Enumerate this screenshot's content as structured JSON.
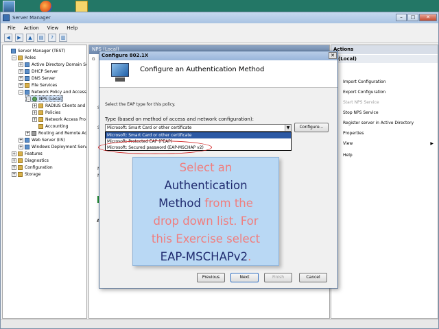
{
  "window": {
    "title": "Server Manager",
    "controls": {
      "minimize": "–",
      "maximize": "□",
      "close": "✕"
    }
  },
  "menu": [
    "File",
    "Action",
    "View",
    "Help"
  ],
  "toolbar_icons": [
    "back-arrow-icon",
    "forward-arrow-icon",
    "up-folder-icon",
    "properties-icon",
    "help-icon",
    "panel-icon"
  ],
  "tree": {
    "items": [
      {
        "label": "Server Manager (TEST)",
        "depth": 0,
        "expander": "",
        "icon": "blue"
      },
      {
        "label": "Roles",
        "depth": 1,
        "expander": "−",
        "icon": "folder"
      },
      {
        "label": "Active Directory Domain Se",
        "depth": 2,
        "expander": "+",
        "icon": "blue"
      },
      {
        "label": "DHCP Server",
        "depth": 2,
        "expander": "+",
        "icon": "blue"
      },
      {
        "label": "DNS Server",
        "depth": 2,
        "expander": "+",
        "icon": "blue"
      },
      {
        "label": "File Services",
        "depth": 2,
        "expander": "+",
        "icon": "folder"
      },
      {
        "label": "Network Policy and Access",
        "depth": 2,
        "expander": "−",
        "icon": "blue"
      },
      {
        "label": "NPS (Local)",
        "depth": 3,
        "expander": "−",
        "icon": "green",
        "selected": true
      },
      {
        "label": "RADIUS Clients and",
        "depth": 4,
        "expander": "+",
        "icon": "folder"
      },
      {
        "label": "Policies",
        "depth": 4,
        "expander": "+",
        "icon": "folder"
      },
      {
        "label": "Network Access Pro",
        "depth": 4,
        "expander": "+",
        "icon": "folder"
      },
      {
        "label": "Accounting",
        "depth": 4,
        "expander": "",
        "icon": "folder"
      },
      {
        "label": "Routing and Remote Ac",
        "depth": 3,
        "expander": "+",
        "icon": "gray"
      },
      {
        "label": "Web Server (IIS)",
        "depth": 2,
        "expander": "+",
        "icon": "blue"
      },
      {
        "label": "Windows Deployment Servi",
        "depth": 2,
        "expander": "+",
        "icon": "blue"
      },
      {
        "label": "Features",
        "depth": 1,
        "expander": "+",
        "icon": "folder"
      },
      {
        "label": "Diagnostics",
        "depth": 1,
        "expander": "+",
        "icon": "folder"
      },
      {
        "label": "Configuration",
        "depth": 1,
        "expander": "+",
        "icon": "folder"
      },
      {
        "label": "Storage",
        "depth": 1,
        "expander": "+",
        "icon": "folder"
      }
    ]
  },
  "center": {
    "header": "NPS (Local)",
    "ghost_letters": [
      "G",
      "S",
      "S",
      "N",
      "N",
      "A"
    ]
  },
  "actions": {
    "header": "Actions",
    "section": "(Local)",
    "items": [
      {
        "label": "Import Configuration",
        "disabled": false
      },
      {
        "label": "Export Configuration",
        "disabled": false
      },
      {
        "label": "Start NPS Service",
        "disabled": true
      },
      {
        "label": "Stop NPS Service",
        "disabled": false
      },
      {
        "label": "Register server in Active Directory",
        "disabled": false
      },
      {
        "label": "Properties",
        "disabled": false
      },
      {
        "label": "View",
        "disabled": false,
        "arrow": "▶"
      },
      {
        "label": "Help",
        "disabled": false
      }
    ]
  },
  "dialog": {
    "title": "Configure 802.1X",
    "close": "✕",
    "heading": "Configure an Authentication Method",
    "instruction": "Select the EAP type for this policy.",
    "type_label": "Type (based on method of access and network configuration):",
    "selected_value": "Microsoft: Smart Card or other certificate",
    "dropdown_arrow": "▼",
    "configure_label": "Configure...",
    "options": [
      {
        "label": "Microsoft: Smart Card or other certificate",
        "selected": true
      },
      {
        "label": "Microsoft: Protected EAP (PEAP)",
        "selected": false
      },
      {
        "label": "Microsoft: Secured password (EAP-MSCHAP v2)",
        "selected": false
      }
    ],
    "buttons": {
      "previous": "Previous",
      "next": "Next",
      "finish": "Finish",
      "cancel": "Cancel"
    }
  },
  "callout": {
    "line1": "Select an",
    "line2": "Authentication",
    "line3a": "Method",
    "line3b": " from the",
    "line4": "drop down list. For",
    "line5": "this Exercise select",
    "line6a": "EAP-MSCHAPv2",
    "line6b": "."
  },
  "colors": {
    "callout_bg": "#b9d8f4",
    "callout_pink": "#f07e7e",
    "callout_navy": "#1f2a6e",
    "selection": "#2c59a4"
  }
}
